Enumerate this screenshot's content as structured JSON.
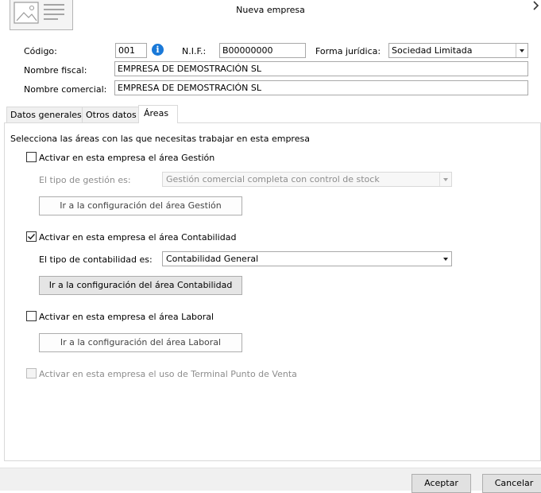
{
  "window": {
    "title": "Nueva empresa"
  },
  "icons": {
    "logo": "image-placeholder-icon",
    "close": "chevron-right-icon",
    "info": "info-icon"
  },
  "colors": {
    "accent": "#1a79d8",
    "button_face": "#e1e1e1"
  },
  "fields": {
    "codigo_label": "Código:",
    "codigo_value": "001",
    "nif_label": "N.I.F.:",
    "nif_value": "B00000000",
    "forma_label": "Forma jurídica:",
    "forma_value": "Sociedad Limitada",
    "nombre_fiscal_label": "Nombre fiscal:",
    "nombre_fiscal_value": "EMPRESA DE DEMOSTRACIÓN SL",
    "nombre_comercial_label": "Nombre comercial:",
    "nombre_comercial_value": "EMPRESA DE DEMOSTRACIÓN SL"
  },
  "tabs": [
    {
      "label": "Datos generales",
      "active": false
    },
    {
      "label": "Otros datos",
      "active": false
    },
    {
      "label": "Áreas",
      "active": true
    }
  ],
  "areas": {
    "intro": "Selecciona las áreas con las que necesitas trabajar en esta empresa",
    "gestion": {
      "checkbox_label": "Activar en esta empresa el área Gestión",
      "checked": false,
      "tipo_label": "El tipo de gestión es:",
      "tipo_value": "Gestión comercial completa con control de stock",
      "button": "Ir a la configuración del área Gestión"
    },
    "contabilidad": {
      "checkbox_label": "Activar en esta empresa el área Contabilidad",
      "checked": true,
      "tipo_label": "El tipo de contabilidad es:",
      "tipo_value": "Contabilidad General",
      "button": "Ir a la configuración del área Contabilidad"
    },
    "laboral": {
      "checkbox_label": "Activar en esta empresa el área Laboral",
      "checked": false,
      "button": "Ir a la configuración del área Laboral"
    },
    "tpv": {
      "checkbox_label": "Activar en esta empresa el uso de Terminal Punto de Venta",
      "checked": false
    }
  },
  "footer": {
    "accept": "Aceptar",
    "cancel": "Cancelar"
  }
}
